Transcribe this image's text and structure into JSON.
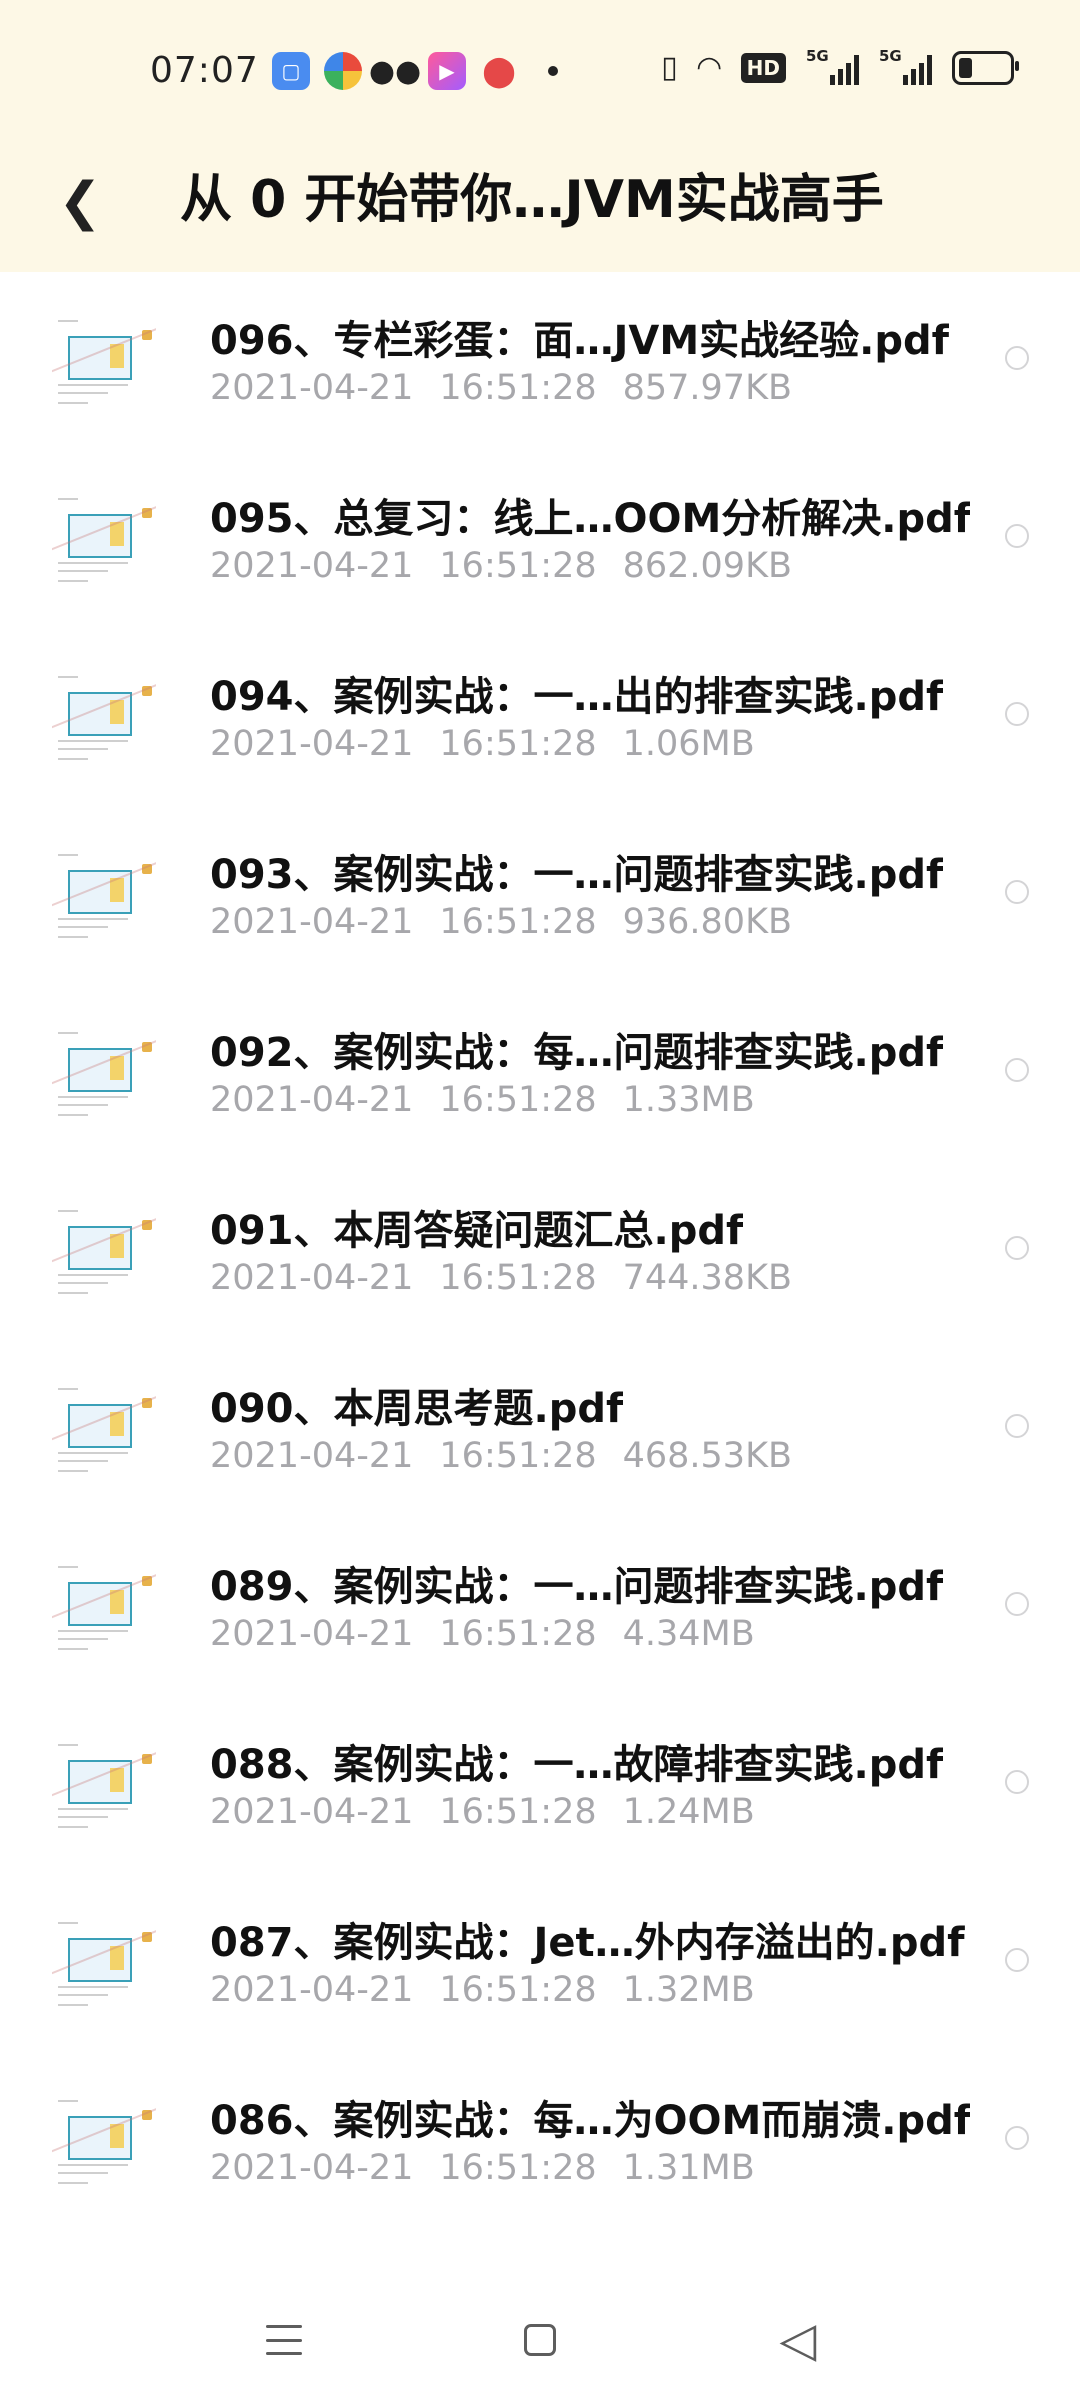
{
  "status_bar": {
    "time": "07:07",
    "notification_icons": [
      "app-icon",
      "browser-icon",
      "wechat-icon",
      "video-app-icon",
      "location-icon"
    ],
    "hd_badge": "HD",
    "network_1": "5G",
    "network_2": "5G",
    "battery_level": 0.3
  },
  "header": {
    "back_glyph": "❮",
    "title": "从 0 开始带你…JVM实战高手"
  },
  "files": [
    {
      "name": "096、专栏彩蛋：面…JVM实战经验.pdf",
      "date": "2021-04-21",
      "time": "16:51:28",
      "size": "857.97KB"
    },
    {
      "name": "095、总复习：线上…OOM分析解决.pdf",
      "date": "2021-04-21",
      "time": "16:51:28",
      "size": "862.09KB"
    },
    {
      "name": "094、案例实战：一…出的排查实践.pdf",
      "date": "2021-04-21",
      "time": "16:51:28",
      "size": "1.06MB"
    },
    {
      "name": "093、案例实战：一…问题排查实践.pdf",
      "date": "2021-04-21",
      "time": "16:51:28",
      "size": "936.80KB"
    },
    {
      "name": "092、案例实战：每…问题排查实践.pdf",
      "date": "2021-04-21",
      "time": "16:51:28",
      "size": "1.33MB"
    },
    {
      "name": "091、本周答疑问题汇总.pdf",
      "date": "2021-04-21",
      "time": "16:51:28",
      "size": "744.38KB"
    },
    {
      "name": "090、本周思考题.pdf",
      "date": "2021-04-21",
      "time": "16:51:28",
      "size": "468.53KB"
    },
    {
      "name": "089、案例实战：一…问题排查实践.pdf",
      "date": "2021-04-21",
      "time": "16:51:28",
      "size": "4.34MB"
    },
    {
      "name": "088、案例实战：一…故障排查实践.pdf",
      "date": "2021-04-21",
      "time": "16:51:28",
      "size": "1.24MB"
    },
    {
      "name": "087、案例实战：Jet…外内存溢出的.pdf",
      "date": "2021-04-21",
      "time": "16:51:28",
      "size": "1.32MB"
    },
    {
      "name": "086、案例实战：每…为OOM而崩溃.pdf",
      "date": "2021-04-21",
      "time": "16:51:28",
      "size": "1.31MB"
    }
  ],
  "nav_bar": {
    "items": [
      "menu-icon",
      "home-icon",
      "back-triangle-icon"
    ]
  },
  "colors": {
    "header_bg": "#fdf8e6",
    "meta_text": "#a7a7ab",
    "title_text": "#111111"
  }
}
